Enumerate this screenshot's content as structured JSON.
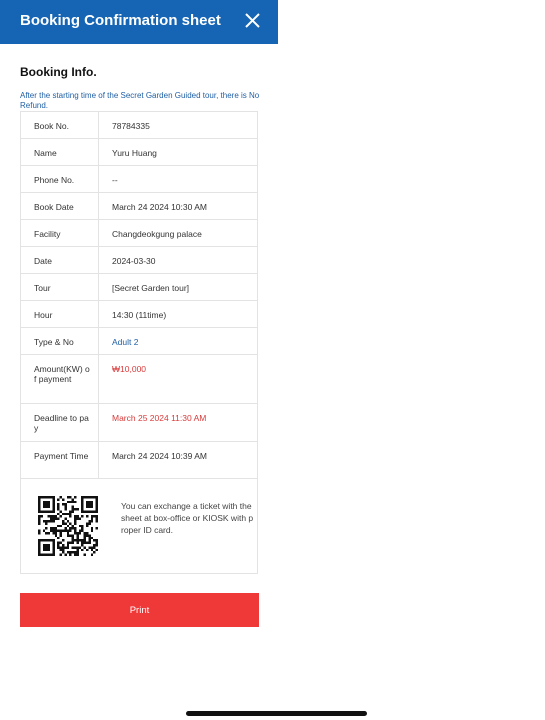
{
  "header": {
    "title": "Booking Confirmation sheet",
    "close_icon": "close-icon"
  },
  "section_title": "Booking Info.",
  "notice": "After the starting time of the Secret Garden Guided tour, there is No Refund.",
  "rows": [
    {
      "label": "Book No.",
      "value": "78784335"
    },
    {
      "label": "Name",
      "value": "Yuru Huang"
    },
    {
      "label": "Phone No.",
      "value": "--"
    },
    {
      "label": "Book Date",
      "value": "March 24 2024 10:30 AM"
    },
    {
      "label": "Facility",
      "value": "Changdeokgung palace"
    },
    {
      "label": "Date",
      "value": "2024-03-30"
    },
    {
      "label": "Tour",
      "value": "[Secret Garden tour]"
    },
    {
      "label": "Hour",
      "value": "14:30 (11time)"
    },
    {
      "label": "Type & No",
      "value": "Adult 2"
    },
    {
      "label": "Amount(KW) of payment",
      "value": "₩10,000"
    },
    {
      "label": "Deadline to pay",
      "value": "March 25 2024 11:30 AM"
    },
    {
      "label": "Payment Time",
      "value": "March 24 2024 10:39 AM"
    }
  ],
  "qr": {
    "icon": "qr-code-icon",
    "text": "You can exchange a ticket with the sheet at box-office or KIOSK with proper ID card."
  },
  "print_label": "Print",
  "colors": {
    "header_bg": "#1565b4",
    "accent_blue": "#1f5fa5",
    "accent_red": "#d83a3a",
    "print_bg": "#ef3939"
  }
}
